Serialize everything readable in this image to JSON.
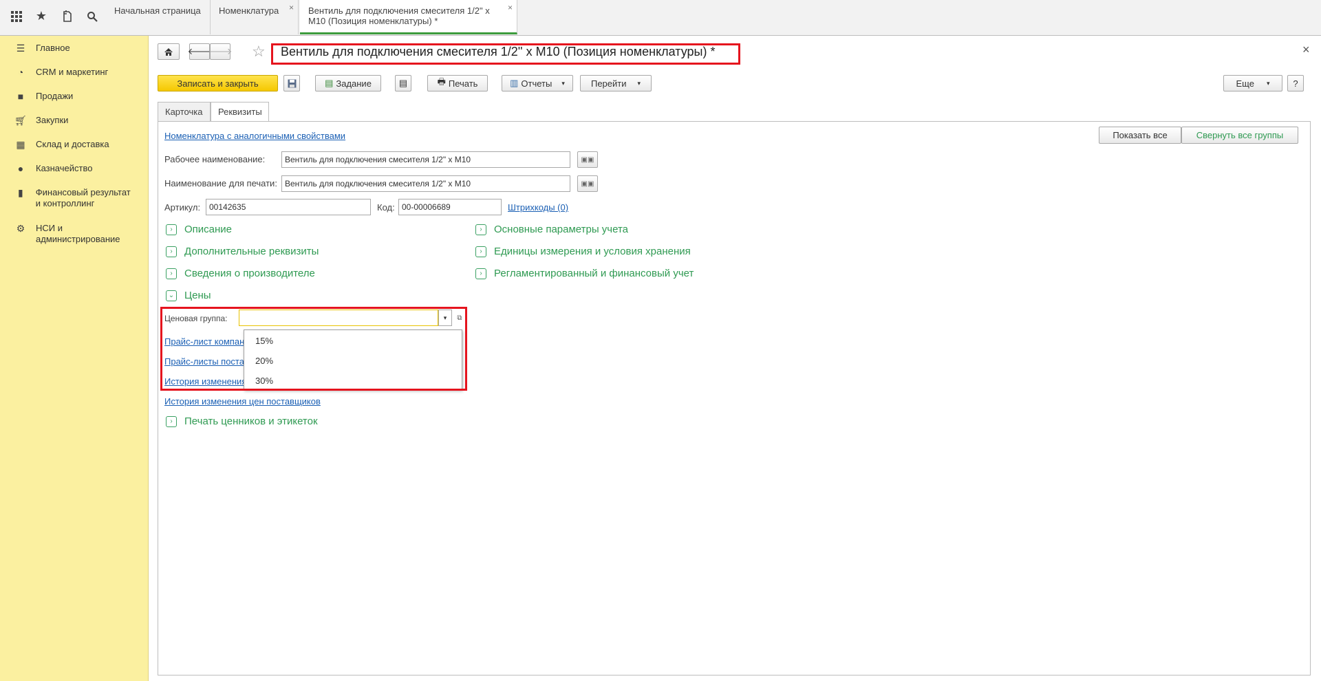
{
  "topbar": {
    "icons": [
      "apps-grid-icon",
      "star-icon",
      "history-icon",
      "search-icon"
    ],
    "tabs": [
      {
        "label": "Начальная страница"
      },
      {
        "label": "Номенклатура"
      },
      {
        "label": "Вентиль для подключения смесителя 1/2\" х М10 (Позиция номенклатуры) *"
      }
    ]
  },
  "sidebar": {
    "items": [
      {
        "label": "Главное",
        "icon": "menu-lines-icon"
      },
      {
        "label": "CRM и маркетинг",
        "icon": "pie-chart-icon"
      },
      {
        "label": "Продажи",
        "icon": "bag-icon"
      },
      {
        "label": "Закупки",
        "icon": "cart-icon"
      },
      {
        "label": "Склад и доставка",
        "icon": "warehouse-icon"
      },
      {
        "label": "Казначейство",
        "icon": "coin-icon"
      },
      {
        "label": "Финансовый результат и контроллинг",
        "icon": "bar-chart-icon"
      },
      {
        "label": "НСИ и администрирование",
        "icon": "gear-icon"
      }
    ]
  },
  "form": {
    "title": "Вентиль для подключения смесителя 1/2'' х М10 (Позиция номенклатуры) *",
    "close_glyph": "×",
    "toolbar": {
      "save_close": "Записать и закрыть",
      "task": "Задание",
      "print": "Печать",
      "reports": "Отчеты",
      "goto": "Перейти",
      "more": "Еще",
      "help": "?"
    },
    "tabs": [
      "Карточка",
      "Реквизиты"
    ],
    "similar_link": "Номенклатура с аналогичными свойствами",
    "show_all": "Показать все",
    "collapse_all": "Свернуть все группы",
    "work_name_label": "Рабочее наименование:",
    "work_name_value": "Вентиль для подключения смесителя 1/2\" х М10",
    "print_name_label": "Наименование для печати:",
    "print_name_value": "Вентиль для подключения смесителя 1/2\" х М10",
    "article_label": "Артикул:",
    "article_value": "00142635",
    "code_label": "Код:",
    "code_value": "00-00006689",
    "barcodes_link": "Штрихкоды (0)",
    "groups_left": [
      "Описание",
      "Дополнительные реквизиты",
      "Сведения о производителе"
    ],
    "groups_right": [
      "Основные параметры учета",
      "Единицы измерения и условия хранения",
      "Регламентированный и финансовый учет"
    ],
    "prices_group": "Цены",
    "price_group_label": "Ценовая группа:",
    "price_group_value": "",
    "price_links": [
      "Прайс-лист компан",
      "Прайс-листы поста",
      "История изменения"
    ],
    "supplier_history_link": "История изменения цен поставщиков",
    "labels_group": "Печать ценников и этикеток",
    "dropdown_options": [
      "15%",
      "20%",
      "30%"
    ]
  }
}
